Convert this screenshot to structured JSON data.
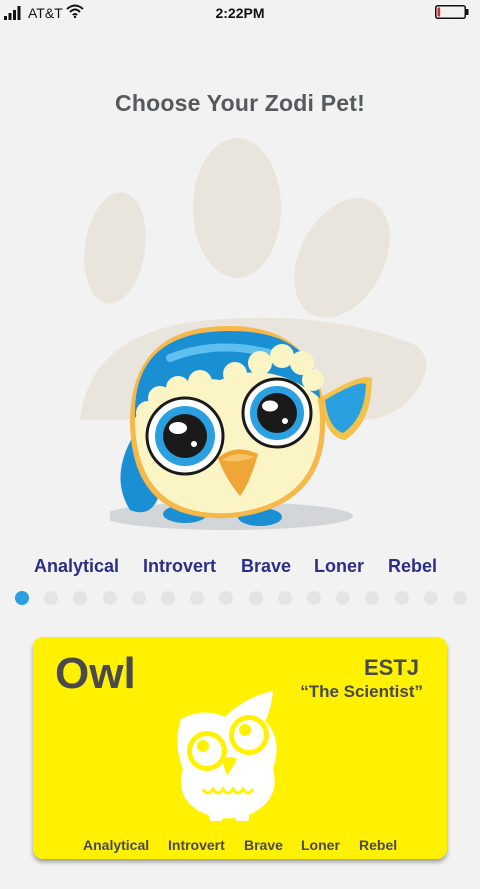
{
  "status_bar": {
    "carrier": "AT&T",
    "time": "2:22PM",
    "battery_level": 0.1,
    "battery_color": "#e0262a"
  },
  "page": {
    "title": "Choose Your Zodi Pet!"
  },
  "selected_pet": {
    "traits": [
      "Analytical",
      "Introvert",
      "Brave",
      "Loner",
      "Rebel"
    ]
  },
  "pager": {
    "count": 16,
    "active_index": 0,
    "active_color": "#2aa0e0"
  },
  "card": {
    "name": "Owl",
    "type": "ESTJ",
    "nickname": "“The Scientist”",
    "traits": [
      "Analytical",
      "Introvert",
      "Brave",
      "Loner",
      "Rebel"
    ],
    "background_color": "#fff100"
  },
  "icons": {
    "signal": "signal-icon",
    "wifi": "wifi-icon",
    "battery": "battery-icon",
    "paw": "paw-print-icon",
    "pet": "owl-pet-icon",
    "card_owl": "owl-silhouette-icon"
  }
}
